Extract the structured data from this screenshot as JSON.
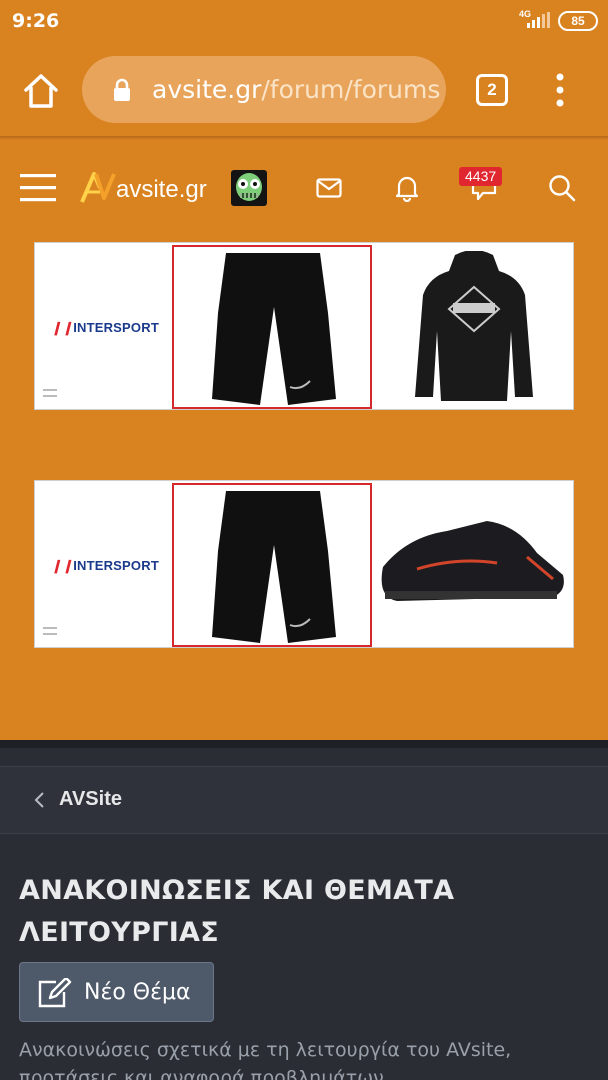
{
  "status_bar": {
    "time": "9:26",
    "network": "4G",
    "battery": "85"
  },
  "browser": {
    "url_host": "avsite.gr",
    "url_path": "/forum/forums",
    "tab_count": "2"
  },
  "header": {
    "logo_text": "avsite.gr",
    "conversations_count": "4437"
  },
  "ads": [
    {
      "brand": "INTERSPORT",
      "brand_mark": "❙❙",
      "product_1": "running-shorts",
      "product_2": "hoodie"
    },
    {
      "brand": "INTERSPORT",
      "brand_mark": "❙❙",
      "product_1": "running-shorts",
      "product_2": "hiking-shoe"
    }
  ],
  "breadcrumb": {
    "label": "AVSite"
  },
  "forum": {
    "title": "ΑΝΑΚΟΙΝΩΣΕΙΣ ΚΑΙ ΘΕΜΑΤΑ ΛΕΙΤΟΥΡΓΙΑΣ",
    "new_thread_label": "Νέο Θέμα",
    "description": "Ανακοινώσεις σχετικά με τη λειτουργία του AVsite, προτάσεις και αναφορά προβλημάτων"
  },
  "colors": {
    "brand_orange": "#d98220",
    "dark_bg": "#2a2d33",
    "badge_red": "#e0272f",
    "ad_frame_red": "#d4282c"
  }
}
